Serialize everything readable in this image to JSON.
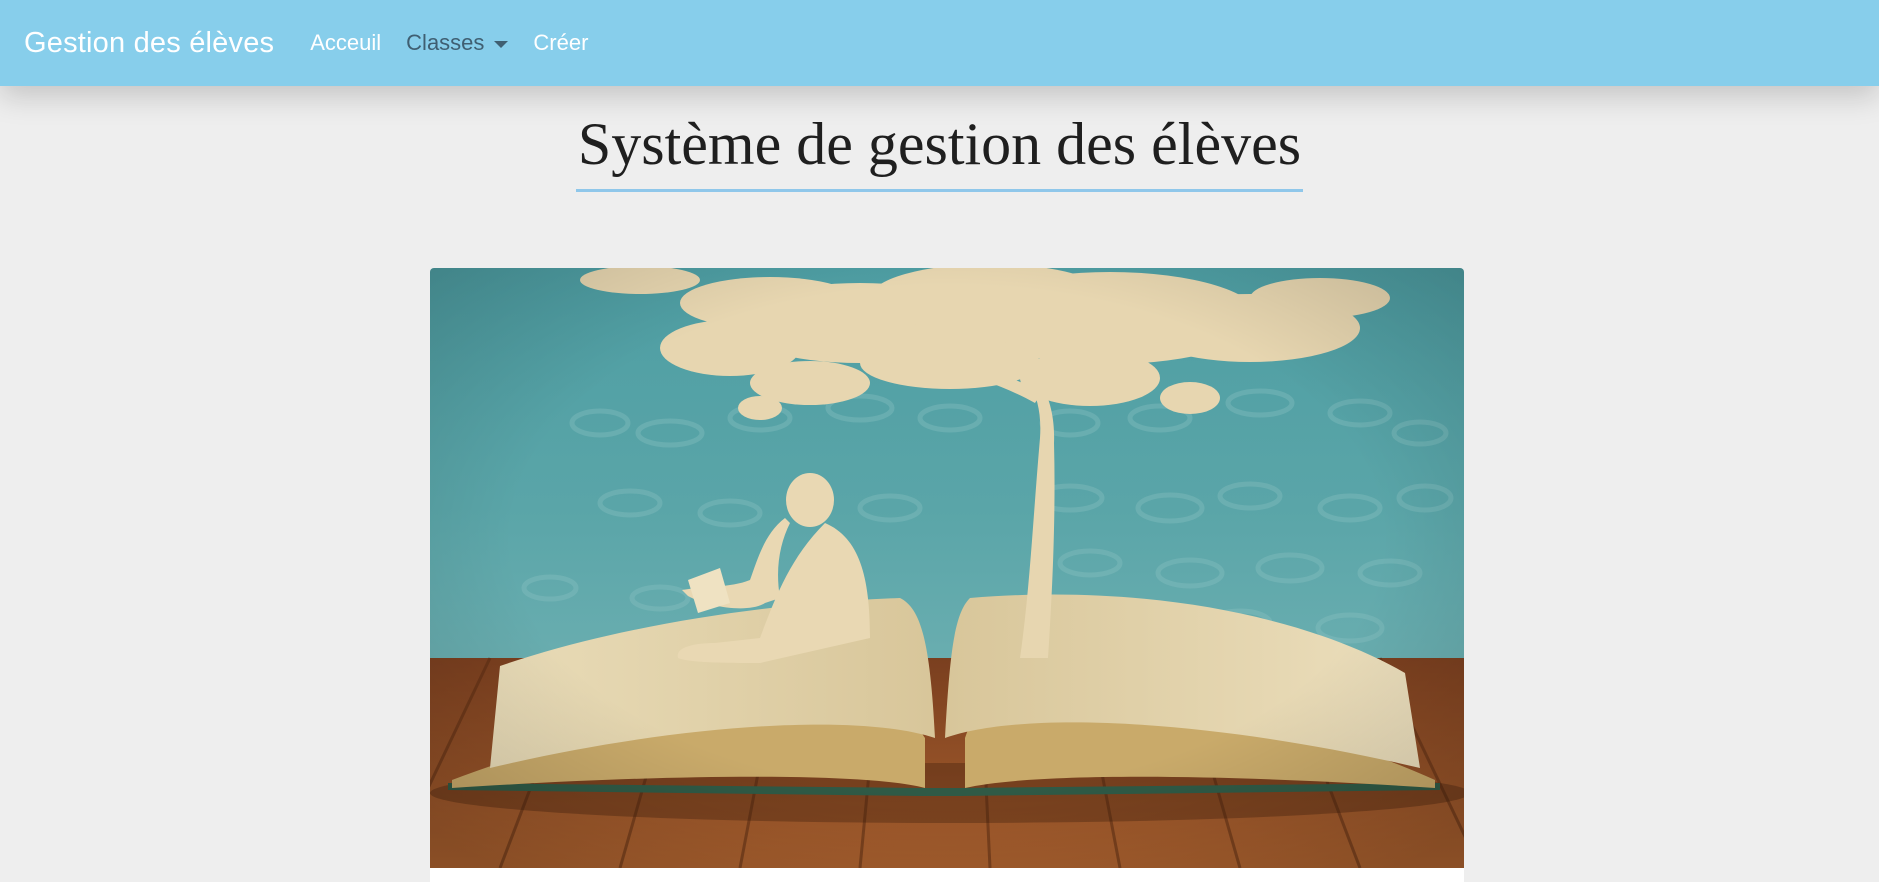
{
  "navbar": {
    "brand": "Gestion des élèves",
    "links": [
      {
        "label": "Acceuil"
      },
      {
        "label": "Classes"
      },
      {
        "label": "Créer"
      }
    ]
  },
  "page": {
    "title": "Système de gestion des élèves"
  },
  "hero": {
    "alt": "Illustration: enfant lisant sous un arbre sur un livre ouvert"
  },
  "colors": {
    "navbar_bg": "#87ceeb",
    "page_bg": "#eeeeee",
    "title_underline": "#8fc7ea",
    "dropdown_text": "#3f5f72"
  }
}
